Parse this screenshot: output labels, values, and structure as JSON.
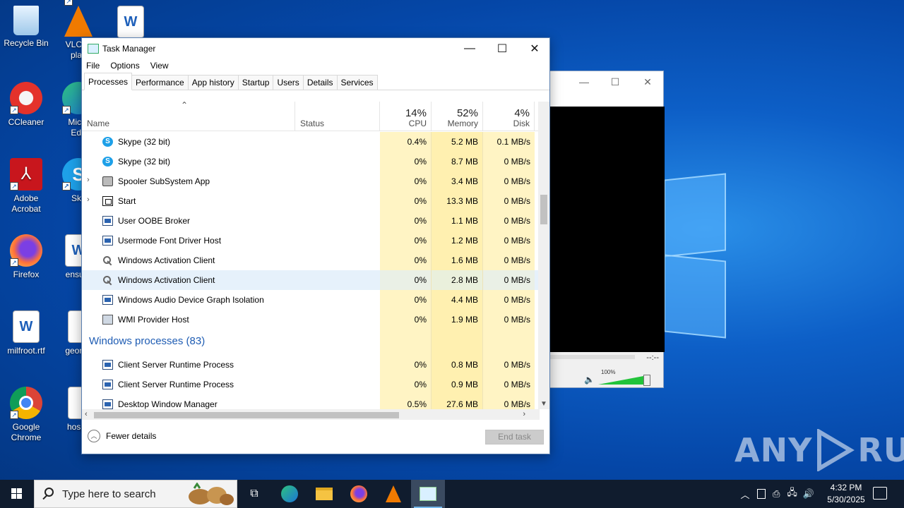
{
  "desktop": {
    "icons": [
      {
        "label": "Recycle Bin"
      },
      {
        "label": "VLC m\nplay"
      },
      {
        "label": "CCleaner"
      },
      {
        "label": "Micro\nEdg"
      },
      {
        "label": "Adobe\nAcrobat"
      },
      {
        "label": "Sky"
      },
      {
        "label": "Firefox"
      },
      {
        "label": "ensure"
      },
      {
        "label": "milfroot.rtf"
      },
      {
        "label": "george"
      },
      {
        "label": "Google\nChrome"
      },
      {
        "label": "hospit"
      }
    ],
    "watermark": {
      "left": "ANY",
      "right": "RUN"
    }
  },
  "media_window": {
    "timecode": "--:--",
    "volume_label": "100%",
    "volume_level": 1.0,
    "accent": "#22c33a"
  },
  "task_manager": {
    "title": "Task Manager",
    "menu": [
      "File",
      "Options",
      "View"
    ],
    "tabs": [
      "Processes",
      "Performance",
      "App history",
      "Startup",
      "Users",
      "Details",
      "Services"
    ],
    "active_tab": "Processes",
    "columns": {
      "name": "Name",
      "status": "Status",
      "cpu": {
        "label": "CPU",
        "pct": "14%"
      },
      "memory": {
        "label": "Memory",
        "pct": "52%"
      },
      "disk": {
        "label": "Disk",
        "pct": "4%"
      }
    },
    "rows": [
      {
        "name": "Skype (32 bit)",
        "icon": "skype-icon",
        "cpu": "0.4%",
        "mem": "5.2 MB",
        "disk": "0.1 MB/s"
      },
      {
        "name": "Skype (32 bit)",
        "icon": "skype-icon",
        "cpu": "0%",
        "mem": "8.7 MB",
        "disk": "0 MB/s"
      },
      {
        "name": "Spooler SubSystem App",
        "icon": "printer-icon",
        "cpu": "0%",
        "mem": "3.4 MB",
        "disk": "0 MB/s"
      },
      {
        "name": "Start",
        "icon": "start-icon",
        "cpu": "0%",
        "mem": "13.3 MB",
        "disk": "0 MB/s"
      },
      {
        "name": "User OOBE Broker",
        "icon": "window-icon",
        "cpu": "0%",
        "mem": "1.1 MB",
        "disk": "0 MB/s"
      },
      {
        "name": "Usermode Font Driver Host",
        "icon": "window-icon",
        "cpu": "0%",
        "mem": "1.2 MB",
        "disk": "0 MB/s"
      },
      {
        "name": "Windows Activation Client",
        "icon": "key-icon",
        "cpu": "0%",
        "mem": "1.6 MB",
        "disk": "0 MB/s"
      },
      {
        "name": "Windows Activation Client",
        "icon": "key-icon",
        "cpu": "0%",
        "mem": "2.8 MB",
        "disk": "0 MB/s"
      },
      {
        "name": "Windows Audio Device Graph Isolation",
        "icon": "window-icon",
        "cpu": "0%",
        "mem": "4.4 MB",
        "disk": "0 MB/s"
      },
      {
        "name": "WMI Provider Host",
        "icon": "wmi-icon",
        "cpu": "0%",
        "mem": "1.9 MB",
        "disk": "0 MB/s"
      }
    ],
    "group": "Windows processes (83)",
    "group_rows": [
      {
        "name": "Client Server Runtime Process",
        "icon": "window-icon",
        "cpu": "0%",
        "mem": "0.8 MB",
        "disk": "0 MB/s"
      },
      {
        "name": "Client Server Runtime Process",
        "icon": "window-icon",
        "cpu": "0%",
        "mem": "0.9 MB",
        "disk": "0 MB/s"
      },
      {
        "name": "Desktop Window Manager",
        "icon": "window-icon",
        "cpu": "0.5%",
        "mem": "27.6 MB",
        "disk": "0 MB/s"
      }
    ],
    "fewer_details": "Fewer details",
    "end_task": "End task"
  },
  "taskbar": {
    "search_placeholder": "Type here to search",
    "clock_time": "4:32 PM",
    "clock_date": "5/30/2025"
  }
}
